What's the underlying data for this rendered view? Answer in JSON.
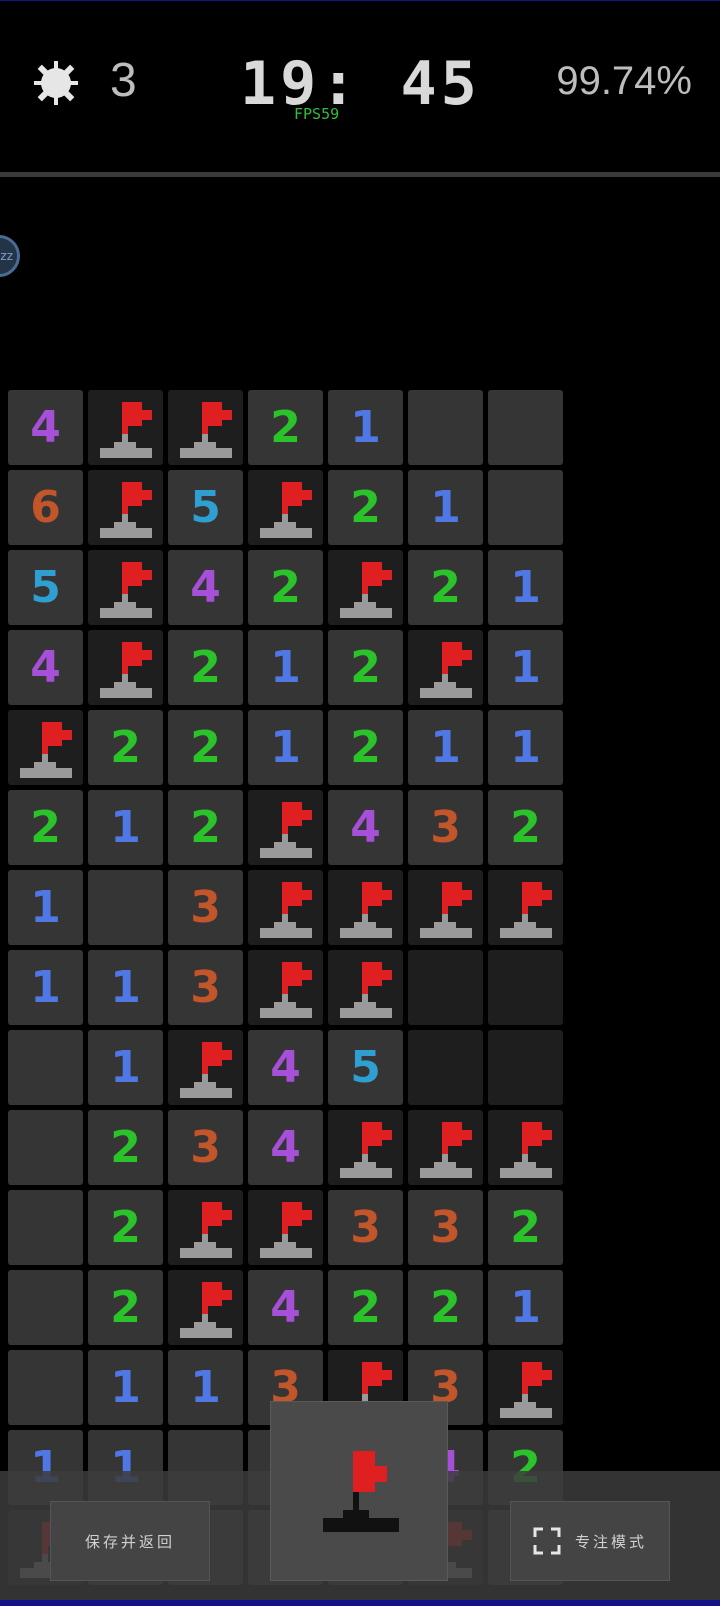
{
  "header": {
    "mine_count": "3",
    "timer": "19: 45",
    "fps": "FPS59",
    "percent": "99.74%"
  },
  "side_button": {
    "label": "zz"
  },
  "board": {
    "rows": [
      [
        "4",
        "F",
        "F",
        "2",
        "1",
        "",
        ""
      ],
      [
        "6",
        "F",
        "5",
        "F",
        "2",
        "1",
        ""
      ],
      [
        "5",
        "F",
        "4",
        "2",
        "F",
        "2",
        "1"
      ],
      [
        "4",
        "F",
        "2",
        "1",
        "2",
        "F",
        "1"
      ],
      [
        "F",
        "2",
        "2",
        "1",
        "2",
        "1",
        "1"
      ],
      [
        "2",
        "1",
        "2",
        "F",
        "4",
        "3",
        "2"
      ],
      [
        "1",
        "",
        "3",
        "F",
        "F",
        "F",
        "F"
      ],
      [
        "1",
        "1",
        "3",
        "F",
        "F",
        "H",
        "H"
      ],
      [
        "",
        "1",
        "F",
        "4",
        "5",
        "H",
        "H"
      ],
      [
        "",
        "2",
        "3",
        "4",
        "F",
        "F",
        "F"
      ],
      [
        "",
        "2",
        "F",
        "F",
        "3",
        "3",
        "2"
      ],
      [
        "",
        "2",
        "F",
        "4",
        "2",
        "2",
        "1"
      ],
      [
        "",
        "1",
        "1",
        "3",
        "F",
        "3",
        "F"
      ],
      [
        "1",
        "1",
        "",
        "",
        "",
        "4",
        "2"
      ],
      [
        "F",
        "",
        "",
        "",
        "",
        "F",
        ""
      ]
    ]
  },
  "bottom": {
    "save_label": "保存并返回",
    "focus_label": "专注模式"
  },
  "colors": {
    "flag_red": "#e02020",
    "flag_pole": "#9a9a9a"
  }
}
